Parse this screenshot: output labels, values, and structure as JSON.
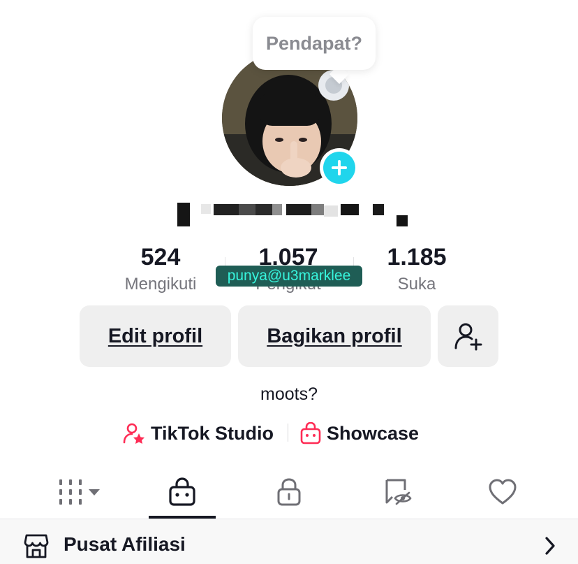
{
  "profile": {
    "tooltip": "Pendapat?",
    "bio": "moots?",
    "watermark": "punya@u3marklee"
  },
  "stats": [
    {
      "value": "524",
      "label": "Mengikuti"
    },
    {
      "value": "1.057",
      "label": "Pengikut"
    },
    {
      "value": "1.185",
      "label": "Suka"
    }
  ],
  "buttons": {
    "edit": "Edit profil",
    "share": "Bagikan profil"
  },
  "links": {
    "studio": "TikTok Studio",
    "showcase": "Showcase"
  },
  "tabs": [
    {
      "name": "grid-tab",
      "icon": "grid-icon"
    },
    {
      "name": "shop-tab",
      "icon": "shopping-bag-icon"
    },
    {
      "name": "private-tab",
      "icon": "lock-icon"
    },
    {
      "name": "reposts-tab",
      "icon": "hidden-tag-icon"
    },
    {
      "name": "liked-tab",
      "icon": "heart-icon"
    }
  ],
  "affiliate": {
    "label": "Pusat Afiliasi"
  },
  "colors": {
    "accent": "#fe2c55",
    "add_button": "#20d5ec",
    "watermark_bg": "#1f5d55",
    "watermark_text": "#37f5dd"
  }
}
